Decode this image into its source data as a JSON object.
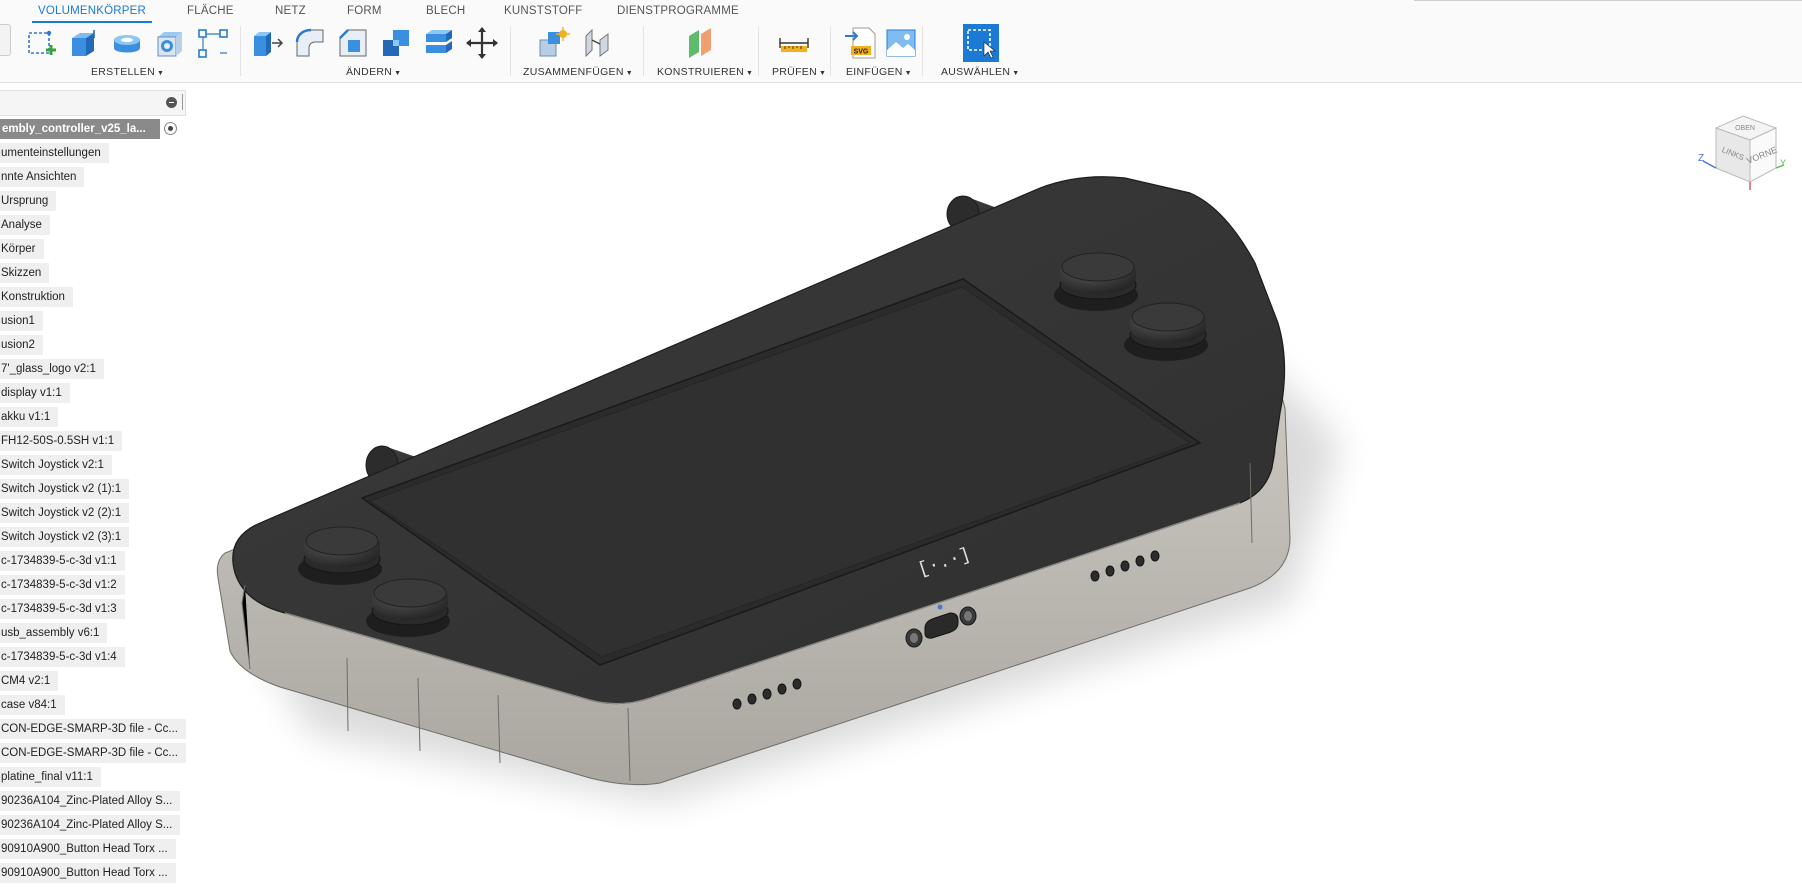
{
  "tabs": [
    "VOLUMENKÖRPER",
    "FLÄCHE",
    "NETZ",
    "FORM",
    "BLECH",
    "KUNSTSTOFF",
    "DIENSTPROGRAMME"
  ],
  "groups": {
    "create": "ERSTELLEN",
    "modify": "ÄNDERN",
    "assemble": "ZUSAMMENFÜGEN",
    "construct": "KONSTRUIEREN",
    "inspect": "PRÜFEN",
    "insert": "EINFÜGEN",
    "select": "AUSWÄHLEN"
  },
  "browser": {
    "root": "embly_controller_v25_la...",
    "items": [
      "umenteinstellungen",
      "nnte Ansichten",
      "Ursprung",
      "Analyse",
      "Körper",
      "Skizzen",
      "Konstruktion",
      "usion1",
      "usion2",
      "7'_glass_logo v2:1",
      "display v1:1",
      "akku v1:1",
      "FH12-50S-0.5SH v1:1",
      "Switch Joystick v2:1",
      "Switch Joystick v2 (1):1",
      "Switch Joystick v2 (2):1",
      "Switch Joystick v2 (3):1",
      "c-1734839-5-c-3d v1:1",
      "c-1734839-5-c-3d v1:2",
      "c-1734839-5-c-3d v1:3",
      "usb_assembly v6:1",
      "c-1734839-5-c-3d v1:4",
      "CM4 v2:1",
      "case v84:1",
      "CON-EDGE-SMARP-3D file - Cc...",
      "CON-EDGE-SMARP-3D file - Cc...",
      "platine_final v11:1",
      "90236A104_Zinc-Plated Alloy S...",
      "90236A104_Zinc-Plated Alloy S...",
      "90910A900_Button Head Torx ...",
      "90910A900_Button Head Torx ..."
    ]
  },
  "viewcube": {
    "top": "OBEN",
    "left": "LINKS",
    "front": "VORNE",
    "axis_z": "Z",
    "axis_y": "Y"
  },
  "model": {
    "logo_text": "[·.·]"
  },
  "colors": {
    "accent": "#1a7ad4",
    "model_top": "#353535",
    "model_side": "#b8b6ae",
    "tree_bg": "#efefef",
    "root_bg": "#8a8a8a"
  }
}
